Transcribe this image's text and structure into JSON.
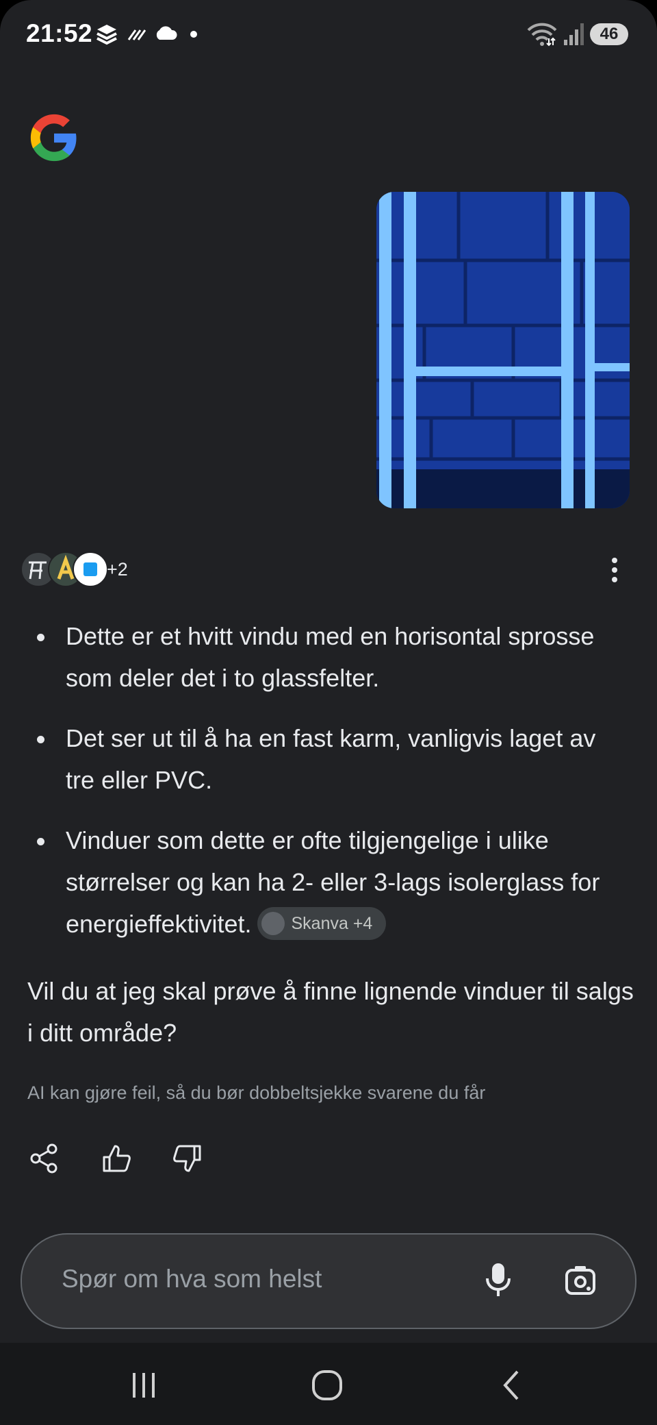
{
  "status_bar": {
    "time": "21:52",
    "battery": "46",
    "icons": [
      "layers-icon",
      "dashed-lines-icon",
      "cloud-icon",
      "dot-icon",
      "wifi-icon",
      "signal-icon",
      "battery-icon"
    ]
  },
  "header": {
    "logo": "google-g-logo"
  },
  "user_image": {
    "alt": ""
  },
  "sources": {
    "avatars": [
      "skanva-source-icon",
      "a-source-icon",
      "blue-square-source-icon"
    ],
    "more_count": "+2"
  },
  "answer": {
    "bullets": [
      "Dette er et hvitt vindu med en horisontal sprosse som deler det i to glassfelter.",
      "Det ser ut til å ha en fast karm, vanligvis laget av tre eller PVC.",
      "Vinduer som dette er ofte tilgjengelige i ulike størrelser og kan ha 2- eller 3-lags isolerglass for energieffektivitet."
    ],
    "citation_chip": "Skanva +4",
    "followup": "Vil du at jeg skal prøve å finne lignende vinduer til salgs i ditt område?",
    "disclaimer": "AI kan gjøre feil, så du bør dobbeltsjekke svarene du får"
  },
  "actions": [
    "share-icon",
    "thumbs-up-icon",
    "thumbs-down-icon"
  ],
  "input": {
    "placeholder": "Spør om hva som helst"
  },
  "nav": [
    "recents-icon",
    "home-icon",
    "back-icon"
  ],
  "colors": {
    "background": "#202124",
    "text": "#e8eaed",
    "muted": "#9aa0a6",
    "image_blue": "#1e4fd8"
  }
}
